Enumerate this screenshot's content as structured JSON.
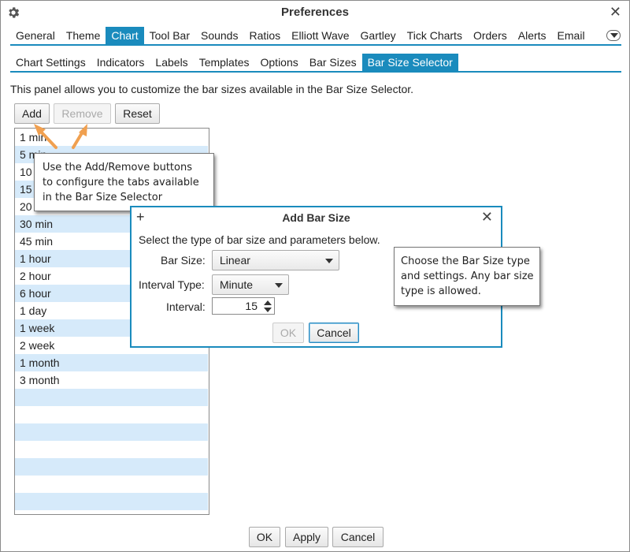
{
  "window": {
    "title": "Preferences",
    "close_glyph": "✕"
  },
  "main_tabs": [
    "General",
    "Theme",
    "Chart",
    "Tool Bar",
    "Sounds",
    "Ratios",
    "Elliott Wave",
    "Gartley",
    "Tick Charts",
    "Orders",
    "Alerts",
    "Email"
  ],
  "main_tab_active": "Chart",
  "sub_tabs": [
    "Chart Settings",
    "Indicators",
    "Labels",
    "Templates",
    "Options",
    "Bar Sizes",
    "Bar Size Selector"
  ],
  "sub_tab_active": "Bar Size Selector",
  "panel": {
    "description": "This panel allows you to customize the bar sizes available in the Bar Size Selector.",
    "add_label": "Add",
    "remove_label": "Remove",
    "reset_label": "Reset"
  },
  "bar_sizes": [
    "1 min",
    "5 min",
    "10 min",
    "15 min",
    "20 min",
    "30 min",
    "45 min",
    "1 hour",
    "2 hour",
    "6 hour",
    "1 day",
    "1 week",
    "2 week",
    "1 month",
    "3 month"
  ],
  "callout_buttons": {
    "line1": "Use the Add/Remove buttons",
    "line2": "to configure the tabs available",
    "line3": "in the Bar Size Selector"
  },
  "dialog": {
    "title": "Add Bar Size",
    "plus_glyph": "+",
    "close_glyph": "✕",
    "instruction": "Select the type of bar size and parameters below.",
    "bar_size_label": "Bar Size:",
    "bar_size_value": "Linear",
    "interval_type_label": "Interval Type:",
    "interval_type_value": "Minute",
    "interval_label": "Interval:",
    "interval_value": "15",
    "ok_label": "OK",
    "cancel_label": "Cancel"
  },
  "callout_dialog": {
    "line1": "Choose the Bar Size type",
    "line2": "and settings. Any bar size",
    "line3": "type is allowed."
  },
  "footer": {
    "ok_label": "OK",
    "apply_label": "Apply",
    "cancel_label": "Cancel"
  },
  "colors": {
    "accent": "#1a8bbd",
    "row_alt": "#d6eafa",
    "arrow": "#f0a050"
  },
  "icons": {
    "settings": "gear-icon",
    "more": "chevron-down-icon"
  }
}
